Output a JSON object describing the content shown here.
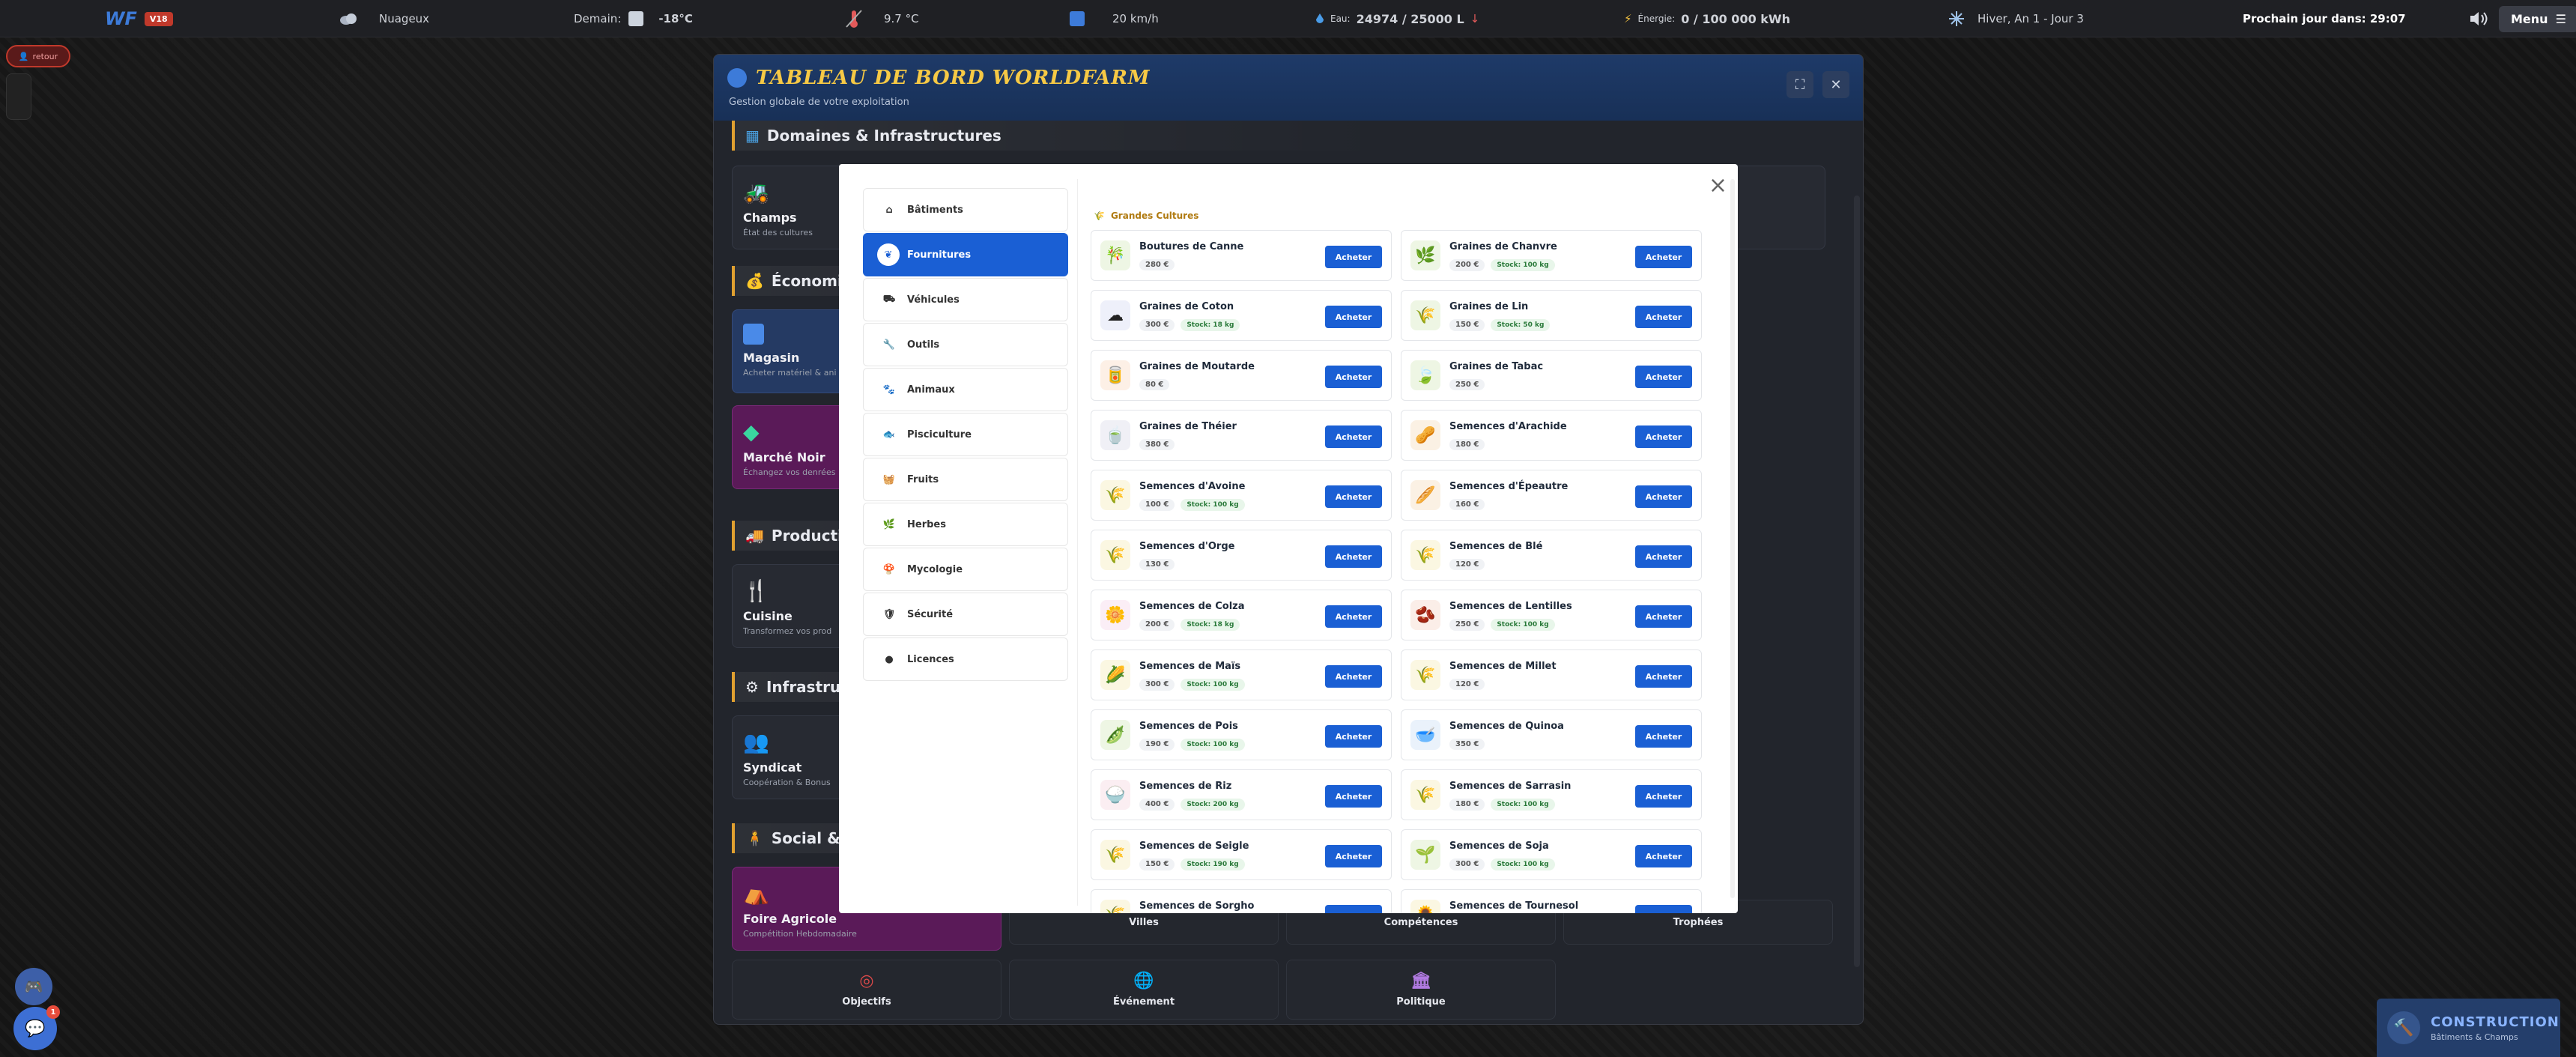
{
  "topbar": {
    "logo": "WF",
    "version": "V18",
    "weather": "Nuageux",
    "tomorrow_label": "Demain:",
    "tomorrow_temp": "-18°C",
    "temperature": "9.7 °C",
    "wind": "20 km/h",
    "water_label": "Eau:",
    "water_value": "24974 / 25000 L",
    "energy_label": "Énergie:",
    "energy_value": "0 / 100 000 kWh",
    "season": "Hiver, An 1 - Jour 3",
    "next_day": "Prochain jour dans: 29:07",
    "menu": "Menu"
  },
  "back_button": "retour",
  "dashboard": {
    "title": "TABLEAU DE BORD WORLDFARM",
    "subtitle": "Gestion globale de votre exploitation",
    "sections": {
      "domains": "Domaines & Infrastructures",
      "economy": "Économie &",
      "production": "Production",
      "infrastructure": "Infrastruct",
      "social": "Social & P"
    },
    "cards": {
      "champs_title": "Champs",
      "champs_sub": "État des cultures",
      "magasin_title": "Magasin",
      "magasin_sub": "Acheter matériel & ani",
      "marche_title": "Marché Noir",
      "marche_sub": "Échangez vos denrées",
      "cuisine_title": "Cuisine",
      "cuisine_sub": "Transformez vos prod",
      "syndicat_title": "Syndicat",
      "syndicat_sub": "Coopération & Bonus",
      "foire_title": "Foire Agricole",
      "foire_sub": "Compétition Hebdomadaire"
    },
    "tiles": {
      "villes": "Villes",
      "competences": "Compétences",
      "trophees": "Trophées",
      "objectifs": "Objectifs",
      "evenement": "Événement",
      "politique": "Politique"
    }
  },
  "shop": {
    "categories": [
      {
        "label": "Bâtiments",
        "icon": "home-icon"
      },
      {
        "label": "Fournitures",
        "icon": "leaf-icon"
      },
      {
        "label": "Véhicules",
        "icon": "tractor-icon"
      },
      {
        "label": "Outils",
        "icon": "wrench-icon"
      },
      {
        "label": "Animaux",
        "icon": "paw-icon"
      },
      {
        "label": "Pisciculture",
        "icon": "fish-icon"
      },
      {
        "label": "Fruits",
        "icon": "basket-icon"
      },
      {
        "label": "Herbes",
        "icon": "herb-icon"
      },
      {
        "label": "Mycologie",
        "icon": "mushroom-icon"
      },
      {
        "label": "Sécurité",
        "icon": "shield-icon"
      },
      {
        "label": "Licences",
        "icon": "license-icon"
      }
    ],
    "section_title": "Grandes Cultures",
    "buy_label": "Acheter",
    "items": [
      {
        "name": "Boutures de Canne",
        "price": "280 €",
        "stock": "",
        "icon": "🎋",
        "bg": "#eef6e4"
      },
      {
        "name": "Graines de Chanvre",
        "price": "200 €",
        "stock": "Stock: 100 kg",
        "icon": "🌿",
        "bg": "#eef6e4"
      },
      {
        "name": "Graines de Coton",
        "price": "300 €",
        "stock": "Stock: 18 kg",
        "icon": "☁",
        "bg": "#eef0fa"
      },
      {
        "name": "Graines de Lin",
        "price": "150 €",
        "stock": "Stock: 50 kg",
        "icon": "🌾",
        "bg": "#eef6e4"
      },
      {
        "name": "Graines de Moutarde",
        "price": "80 €",
        "stock": "",
        "icon": "🥫",
        "bg": "#fdf0e6"
      },
      {
        "name": "Graines de Tabac",
        "price": "250 €",
        "stock": "",
        "icon": "🍃",
        "bg": "#eef6e4"
      },
      {
        "name": "Graines de Théier",
        "price": "380 €",
        "stock": "",
        "icon": "🍵",
        "bg": "#f0f0f6"
      },
      {
        "name": "Semences d'Arachide",
        "price": "180 €",
        "stock": "",
        "icon": "🥜",
        "bg": "#fbf1e4"
      },
      {
        "name": "Semences d'Avoine",
        "price": "100 €",
        "stock": "Stock: 100 kg",
        "icon": "🌾",
        "bg": "#fbf7e2"
      },
      {
        "name": "Semences d'Épeautre",
        "price": "160 €",
        "stock": "",
        "icon": "🥖",
        "bg": "#fbf1e4"
      },
      {
        "name": "Semences d'Orge",
        "price": "130 €",
        "stock": "",
        "icon": "🌾",
        "bg": "#fbf7e2"
      },
      {
        "name": "Semences de Blé",
        "price": "120 €",
        "stock": "",
        "icon": "🌾",
        "bg": "#fbf7e2"
      },
      {
        "name": "Semences de Colza",
        "price": "200 €",
        "stock": "Stock: 18 kg",
        "icon": "🌼",
        "bg": "#fbeef6"
      },
      {
        "name": "Semences de Lentilles",
        "price": "250 €",
        "stock": "Stock: 100 kg",
        "icon": "🫘",
        "bg": "#fbeee8"
      },
      {
        "name": "Semences de Maïs",
        "price": "300 €",
        "stock": "Stock: 100 kg",
        "icon": "🌽",
        "bg": "#fbf7e2"
      },
      {
        "name": "Semences de Millet",
        "price": "120 €",
        "stock": "",
        "icon": "🌾",
        "bg": "#fbf7e2"
      },
      {
        "name": "Semences de Pois",
        "price": "190 €",
        "stock": "Stock: 100 kg",
        "icon": "🫛",
        "bg": "#eef6e4"
      },
      {
        "name": "Semences de Quinoa",
        "price": "350 €",
        "stock": "",
        "icon": "🥣",
        "bg": "#eaf2fb"
      },
      {
        "name": "Semences de Riz",
        "price": "400 €",
        "stock": "Stock: 200 kg",
        "icon": "🍚",
        "bg": "#fbeef2"
      },
      {
        "name": "Semences de Sarrasin",
        "price": "180 €",
        "stock": "Stock: 100 kg",
        "icon": "🌾",
        "bg": "#fbf7e2"
      },
      {
        "name": "Semences de Seigle",
        "price": "150 €",
        "stock": "Stock: 190 kg",
        "icon": "🌾",
        "bg": "#fbf7e2"
      },
      {
        "name": "Semences de Soja",
        "price": "300 €",
        "stock": "Stock: 100 kg",
        "icon": "🌱",
        "bg": "#eef6e4"
      },
      {
        "name": "Semences de Sorgho",
        "price": "",
        "stock": "",
        "icon": "🌾",
        "bg": "#fbf7e2"
      },
      {
        "name": "Semences de Tournesol",
        "price": "",
        "stock": "",
        "icon": "🌻",
        "bg": "#fbf7e2"
      }
    ]
  },
  "bottom": {
    "notif_count": "1",
    "construction_title": "CONSTRUCTION",
    "construction_sub": "Bâtiments & Champs"
  }
}
